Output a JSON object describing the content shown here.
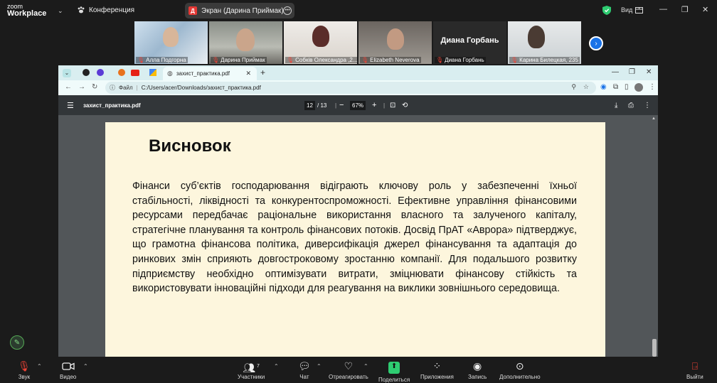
{
  "zoom": {
    "brand_small": "zoom",
    "brand_big": "Workplace",
    "meeting_title": "Конференция",
    "share_label": "Экран (Дарина Приймак)",
    "share_badge": "Д",
    "view_label": "Вид"
  },
  "participants": [
    {
      "name": "Алла Подгорна",
      "muted": true
    },
    {
      "name": "Дарина Приймак",
      "muted": true,
      "active": true
    },
    {
      "name": "Собків Олександра ,2...",
      "muted": true
    },
    {
      "name": "Elizabeth Neverova",
      "muted": true
    },
    {
      "name": "Диана Горбань",
      "muted": true,
      "big_name": "Диана Горбань"
    },
    {
      "name": "Карина Билецкая, 235",
      "muted": true
    }
  ],
  "browser": {
    "tab_title": "захист_практика.pdf",
    "address_label": "Файл",
    "address": "C:/Users/acer/Downloads/захист_практика.pdf"
  },
  "pdf": {
    "filename": "захист_практика.pdf",
    "page_current": "12",
    "page_total": "/ 13",
    "zoom": "67%",
    "heading": "Висновок",
    "body": "Фінанси суб’єктів господарювання відіграють ключову роль у забезпеченні їхньої стабільності, ліквідності та конкурентоспроможності. Ефективне управління фінансовими ресурсами передбачає раціональне використання власного та залученого капіталу, стратегічне планування та контроль фінансових потоків. Досвід ПрАТ «Аврора» підтверджує, що грамотна фінансова політика, диверсифікація джерел фінансування та адаптація до ринкових змін сприяють довгостроковому зростанню компанії. Для подальшого розвитку підприємству необхідно оптимізувати витрати, зміцнювати фінансову стійкість та використовувати інноваційні підходи для реагування на виклики зовнішнього середовища."
  },
  "toolbar": {
    "audio": "Звук",
    "video": "Видео",
    "participants": "Участники",
    "participants_count": "7",
    "chat": "Чат",
    "react": "Отреагировать",
    "share": "Поделиться",
    "apps": "Приложения",
    "record": "Запись",
    "more": "Дополнительно",
    "leave": "Выйти"
  }
}
